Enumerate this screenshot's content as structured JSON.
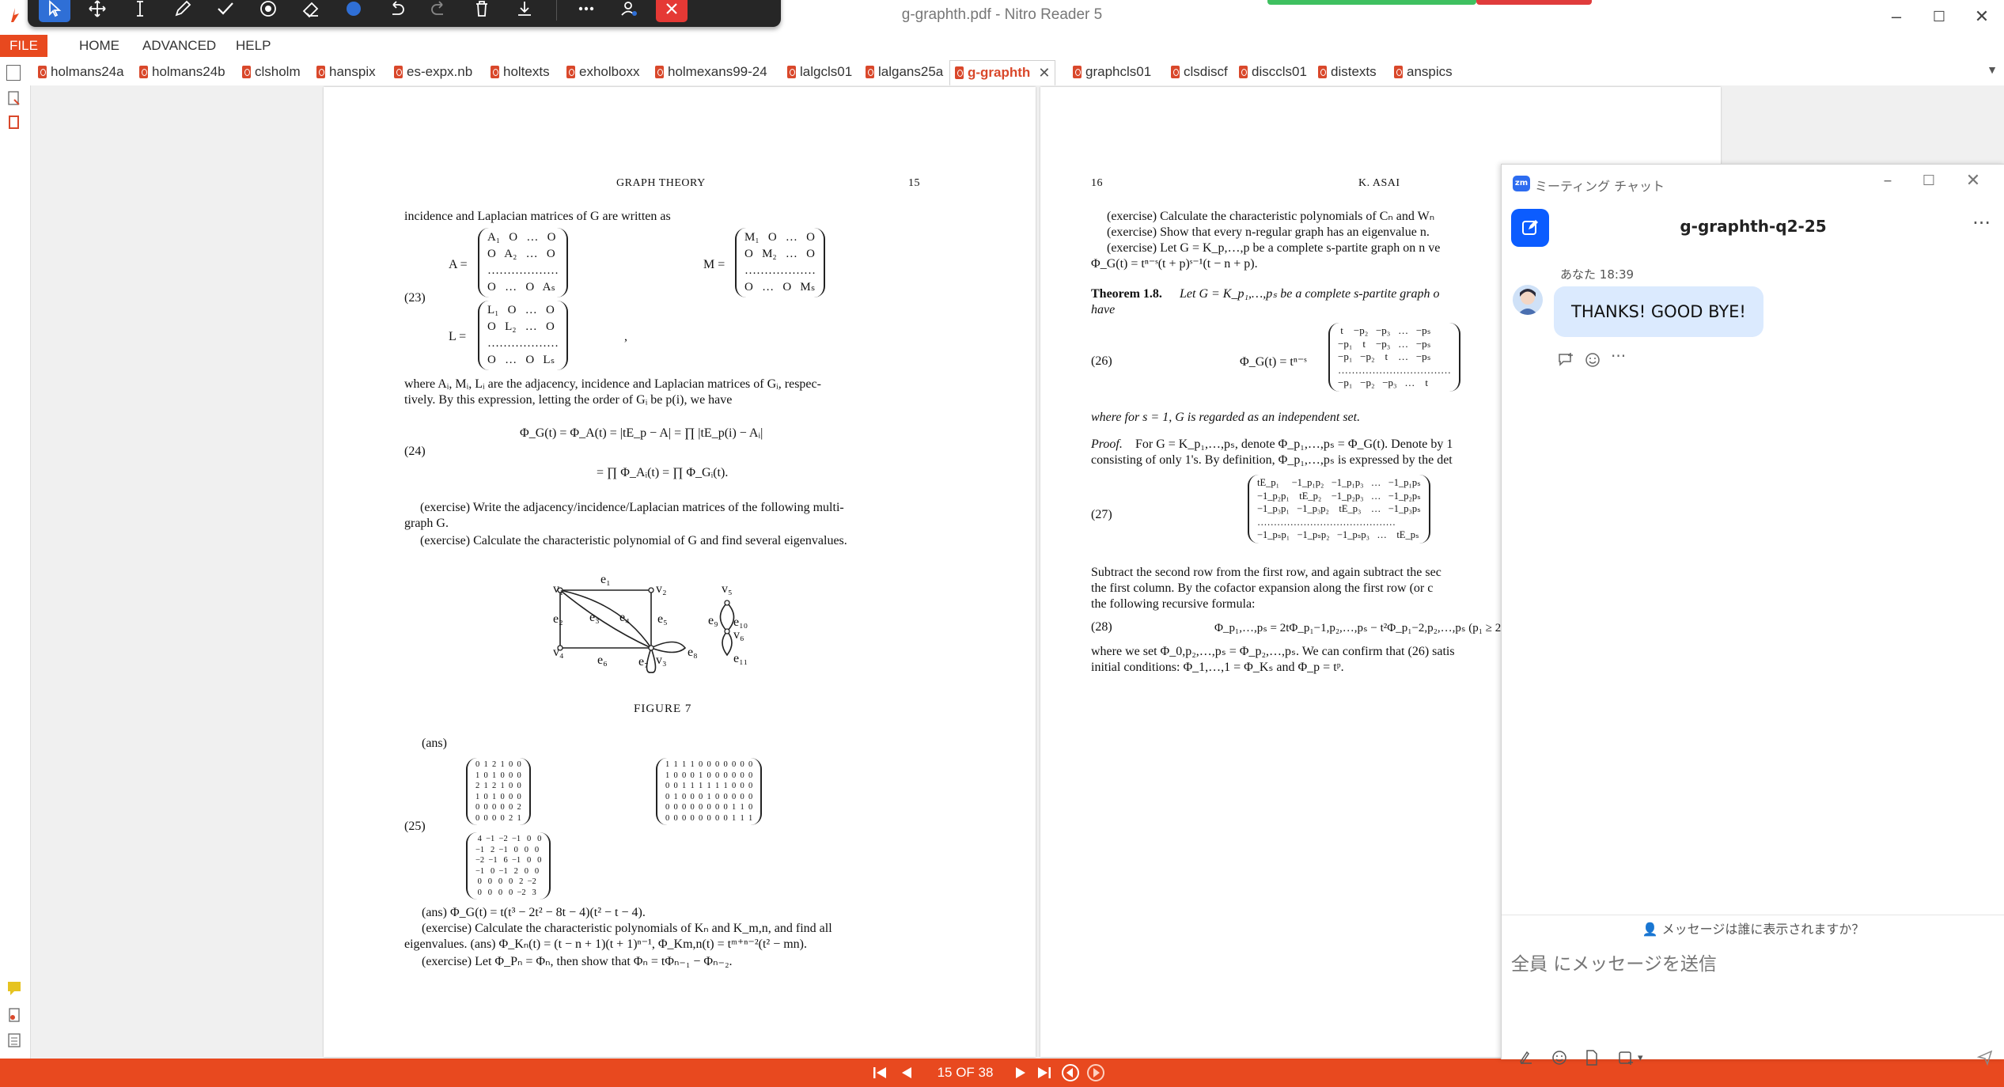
{
  "window": {
    "title": "g-graphth.pdf - Nitro Reader 5",
    "controls": [
      "–",
      "☐",
      "✕"
    ]
  },
  "menu": [
    "FILE",
    "HOME",
    "ADVANCED",
    "HELP"
  ],
  "tabs": [
    {
      "label": "holmans24a"
    },
    {
      "label": "holmans24b"
    },
    {
      "label": "clsholm"
    },
    {
      "label": "hanspix"
    },
    {
      "label": "es-expx.nb"
    },
    {
      "label": "holtexts"
    },
    {
      "label": "exholboxx"
    },
    {
      "label": "holmexans99-24"
    },
    {
      "label": "lalgcls01"
    },
    {
      "label": "lalgans25a"
    },
    {
      "label": "g-graphth",
      "active": true
    },
    {
      "label": "graphcls01"
    },
    {
      "label": "clsdiscf"
    },
    {
      "label": "disccls01"
    },
    {
      "label": "distexts"
    },
    {
      "label": "anspics"
    }
  ],
  "page15": {
    "header_title": "GRAPH THEORY",
    "header_num": "15",
    "line1": "incidence and Laplacian matrices of G are written as",
    "eq23": "(23)",
    "A_label": "A =",
    "A_rows": "A₁   O   …   O\nO   A₂   …   O\n………………\nO   …   O   Aₛ",
    "M_label": "M =",
    "M_rows": "M₁   O   …   O\nO   M₂   …   O\n………………\nO   …   O   Mₛ",
    "L_label": "L =",
    "L_rows": "L₁   O   …   O\nO   L₂   …   O\n………………\nO   …   O   Lₛ",
    "line2": "where Aᵢ, Mᵢ, Lᵢ are the adjacency, incidence and Laplacian matrices of Gᵢ, respec-",
    "line3": "tively. By this expression, letting the order of Gᵢ be p(i), we have",
    "eq24": "(24)",
    "eq24a": "Φ_G(t)   = Φ_A(t) = |tE_p − A| = ∏ |tE_p(i) − Aᵢ|",
    "eq24b": "= ∏ Φ_Aᵢ(t) = ∏ Φ_Gᵢ(t).",
    "ex1a": "(exercise) Write the adjacency/incidence/Laplacian matrices of the following multi-",
    "ex1b": "graph G.",
    "ex2": "(exercise) Calculate the characteristic polynomial of G and find several eigenvalues.",
    "fig": {
      "v1": "v₁",
      "v2": "v₂",
      "v3": "v₃",
      "v4": "v₄",
      "v5": "v₅",
      "v6": "v₆",
      "e1": "e₁",
      "e2": "e₂",
      "e3": "e₃",
      "e4": "e₄",
      "e5": "e₅",
      "e6": "e₆",
      "e7": "e₇",
      "e8": "e₈",
      "e9": "e₉",
      "e10": "e₁₀",
      "e11": "e₁₁",
      "caption": "FIGURE 7"
    },
    "ans_label": "(ans)",
    "eq25": "(25)",
    "mat_adj": "0  1  2  1  0  0\n1  0  1  0  0  0\n2  1  2  1  0  0\n1  0  1  0  0  0\n0  0  0  0  0  2\n0  0  0  0  2  1",
    "mat_inc": "1  1  1  1  0  0  0  0  0  0  0\n1  0  0  0  1  0  0  0  0  0  0\n0  0  1  1  1  1  1  1  0  0  0\n0  1  0  0  0  1  0  0  0  0  0\n0  0  0  0  0  0  0  0  1  1  0\n0  0  0  0  0  0  0  0  1  1  1",
    "mat_lap": " 4  −1  −2  −1   0   0\n−1   2  −1   0   0   0\n−2  −1   6  −1   0   0\n−1   0  −1   2   0   0\n 0   0   0   0   2  −2\n 0   0   0   0  −2   3",
    "ans2": "(ans) Φ_G(t) = t(t³ − 2t² − 8t − 4)(t² − t − 4).",
    "ex3a": "(exercise) Calculate the characteristic polynomials of Kₙ and K_m,n, and find all",
    "ex3b": "eigenvalues.  (ans) Φ_Kₙ(t) = (t − n + 1)(t + 1)ⁿ⁻¹, Φ_Km,n(t) = tᵐ⁺ⁿ⁻²(t² − mn).",
    "ex4": "(exercise) Let Φ_Pₙ = Φₙ, then show that Φₙ = tΦₙ₋₁ − Φₙ₋₂."
  },
  "page16": {
    "header_num": "16",
    "header_title": "K. ASAI",
    "l1": "(exercise) Calculate the characteristic polynomials of Cₙ and Wₙ",
    "l2": "(exercise) Show that every n-regular graph has an eigenvalue n.",
    "l3": "(exercise) Let G = K_p,…,p be a complete s-partite graph on n ve",
    "l4": "Φ_G(t) = tⁿ⁻ˢ(t + p)ˢ⁻¹(t − n + p).",
    "thm_bold": "Theorem 1.8.",
    "thm_text": "Let G = K_p₁,…,pₛ be a complete s-partite graph o",
    "thm_have": "have",
    "eq26": "(26)",
    "eq26_lhs": "Φ_G(t) = tⁿ⁻ˢ",
    "mat26": " t    −p₂   −p₃   …   −pₛ\n−p₁    t    −p₃   …   −pₛ\n−p₁   −p₂    t    …   −pₛ\n……………………………\n−p₁   −p₂   −p₃   …    t",
    "where1": "where for s = 1, G is regarded as an independent set.",
    "proof_it": "Proof.",
    "proof_text": "For G = K_p₁,…,pₛ, denote Φ_p₁,…,pₛ = Φ_G(t). Denote by 1",
    "proof2": "consisting of only 1's. By definition, Φ_p₁,…,pₛ is expressed by the det",
    "eq27": "(27)",
    "mat27": "tE_p₁     −1_p₁p₂   −1_p₁p₃   …   −1_p₁pₛ\n−1_p₂p₁    tE_p₂    −1_p₂p₃   …   −1_p₂pₛ\n−1_p₃p₁   −1_p₃p₂    tE_p₃    …   −1_p₃pₛ\n……………………………………\n−1_pₛp₁   −1_pₛp₂   −1_pₛp₃   …    tE_pₛ",
    "sub1": "Subtract the second row from the first row, and again subtract the sec",
    "sub2": "the first column. By the cofactor expansion along the first row (or c",
    "sub3": "the following recursive formula:",
    "eq28": "(28)",
    "eq28_body": "Φ_p₁,…,pₛ = 2tΦ_p₁−1,p₂,…,pₛ − t²Φ_p₁−2,p₂,…,pₛ    (p₁ ≥ 2",
    "fin1": "where we set Φ_0,p₂,…,pₛ = Φ_p₂,…,pₛ. We can confirm that (26) satis",
    "fin2": "initial conditions: Φ_1,…,1 = Φ_Kₛ and Φ_p = tᵖ."
  },
  "nav": {
    "page_indicator": "15 OF 38"
  },
  "zoom_chat": {
    "logo": "zm",
    "window_title": "ミーティング チャット",
    "chat_title": "g-graphth-q2-25",
    "sender": "あなた",
    "time": "18:39",
    "message": "THANKS! GOOD BYE!",
    "more": "···",
    "visibility_note": "メッセージは誰に表示されますか？",
    "input_placeholder": "全員 にメッセージを送信"
  },
  "colors": {
    "accent": "#e8491f",
    "zoom_blue": "#0b5cff",
    "bubble": "#dbeafe"
  }
}
